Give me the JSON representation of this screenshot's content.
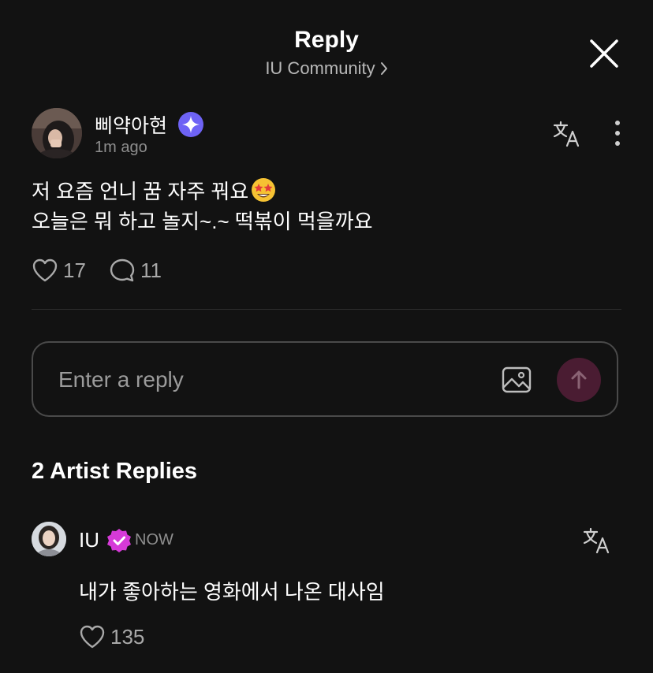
{
  "header": {
    "title": "Reply",
    "community": "IU Community"
  },
  "post": {
    "author": "삐약아현",
    "time": "1m ago",
    "lines": [
      "저 요즘 언니 꿈 자주 꿔요",
      "오늘은 뭐 하고 놀지~.~ 떡볶이 먹을까요"
    ],
    "emoji": "star-struck-emoji",
    "likes": "17",
    "comments": "11"
  },
  "reply_input": {
    "placeholder": "Enter a reply"
  },
  "artist_replies": {
    "title": "2 Artist Replies",
    "items": [
      {
        "name": "IU",
        "time": "NOW",
        "text": "내가 좋아하는 영화에서 나온 대사임",
        "likes": "135"
      }
    ]
  },
  "colors": {
    "background": "#121212",
    "send_button": "#4a1c32",
    "verified_badge": "#d63ad8",
    "fan_badge": "#6e63f5"
  },
  "icons": [
    "close-icon",
    "chevron-right-icon",
    "sparkle-badge-icon",
    "translate-icon",
    "more-vertical-icon",
    "heart-icon",
    "comment-icon",
    "image-icon",
    "arrow-up-icon",
    "verified-icon"
  ]
}
